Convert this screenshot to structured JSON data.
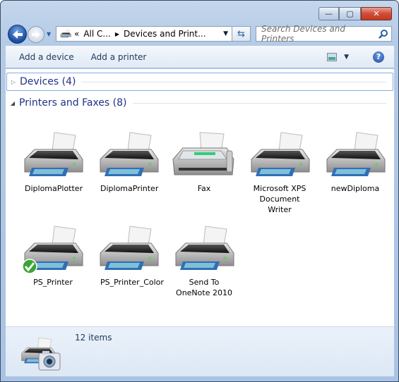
{
  "window": {
    "minimize": "—",
    "maximize": "▢",
    "close": "✕"
  },
  "address": {
    "overflow": "«",
    "crumbs": [
      "All C...",
      "Devices and Print..."
    ]
  },
  "search": {
    "placeholder": "Search Devices and Printers"
  },
  "toolbar": {
    "add_device": "Add a device",
    "add_printer": "Add a printer"
  },
  "groups": {
    "devices": "Devices (4)",
    "printers": "Printers and Faxes (8)"
  },
  "items": [
    {
      "label": "DiplomaPlotter",
      "type": "printer"
    },
    {
      "label": "DiplomaPrinter",
      "type": "printer"
    },
    {
      "label": "Fax",
      "type": "fax"
    },
    {
      "label": "Microsoft XPS Document Writer",
      "type": "printer"
    },
    {
      "label": "newDiploma",
      "type": "printer"
    },
    {
      "label": "PS_Printer",
      "type": "printer",
      "default": true
    },
    {
      "label": "PS_Printer_Color",
      "type": "printer"
    },
    {
      "label": "Send To OneNote 2010",
      "type": "printer"
    }
  ],
  "status": {
    "count": "12 items"
  },
  "colors": {
    "group_header": "#1e3287",
    "toolbar_text": "#1e395b",
    "default_check": "#3aa535"
  }
}
